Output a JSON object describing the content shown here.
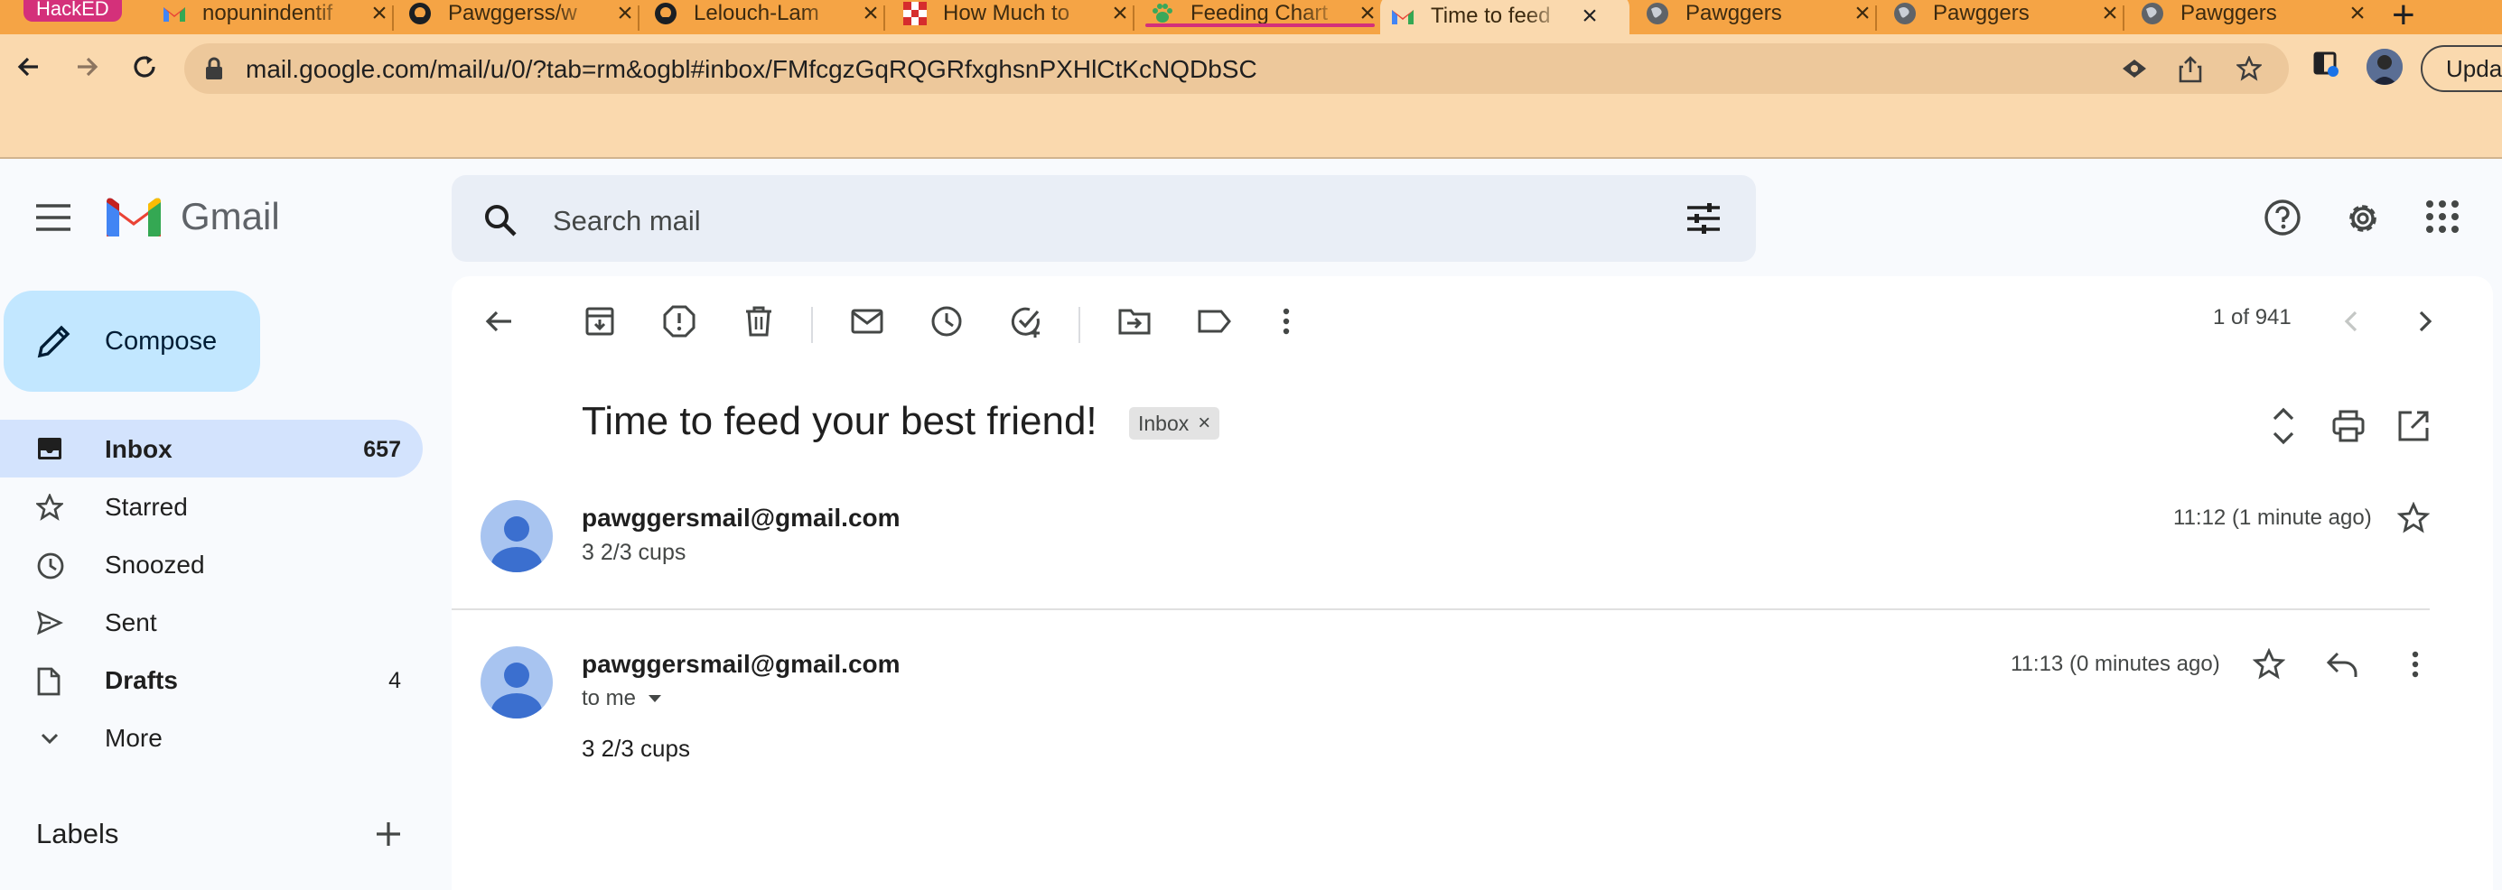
{
  "browser": {
    "badge": "HackED",
    "tabs": [
      {
        "title": "nopunindentif",
        "favicon": "gmail-icon"
      },
      {
        "title": "Pawggerss/w",
        "favicon": "github-icon"
      },
      {
        "title": "Lelouch-Lam",
        "favicon": "github-icon"
      },
      {
        "title": "How Much to",
        "favicon": "checker-icon"
      },
      {
        "title": "Feeding Chart",
        "favicon": "paw-icon"
      },
      {
        "title": "Time to feed",
        "favicon": "gmail-icon",
        "active": true
      },
      {
        "title": "Pawggers",
        "favicon": "globe-icon"
      },
      {
        "title": "Pawggers",
        "favicon": "globe-icon"
      },
      {
        "title": "Pawggers",
        "favicon": "globe-icon"
      }
    ],
    "url": "mail.google.com/mail/u/0/?tab=rm&ogbl#inbox/FMfcgzGqRQGRfxghsnPXHlCtKcNQDbSC",
    "update_label": "Update"
  },
  "gmail": {
    "logo_text": "Gmail",
    "search_placeholder": "Search mail",
    "compose_label": "Compose",
    "nav": [
      {
        "label": "Inbox",
        "count": "657"
      },
      {
        "label": "Starred",
        "count": ""
      },
      {
        "label": "Snoozed",
        "count": ""
      },
      {
        "label": "Sent",
        "count": ""
      },
      {
        "label": "Drafts",
        "count": "4"
      },
      {
        "label": "More",
        "count": ""
      }
    ],
    "labels_title": "Labels"
  },
  "thread": {
    "pager": "1 of 941",
    "subject": "Time to feed your best friend!",
    "label_chip": "Inbox",
    "messages": [
      {
        "sender": "pawggersmail@gmail.com",
        "snippet": "3 2/3 cups",
        "time": "11:12 (1 minute ago)"
      },
      {
        "sender": "pawggersmail@gmail.com",
        "recipient": "to me",
        "body": "3 2/3 cups",
        "time": "11:13 (0 minutes ago)"
      }
    ]
  },
  "colors": {
    "tabstrip": "#f5a445",
    "toolbar": "#fad9ae",
    "hacked_badge": "#d4307a",
    "compose": "#c2e7ff",
    "selected_nav": "#d3e3fd"
  }
}
